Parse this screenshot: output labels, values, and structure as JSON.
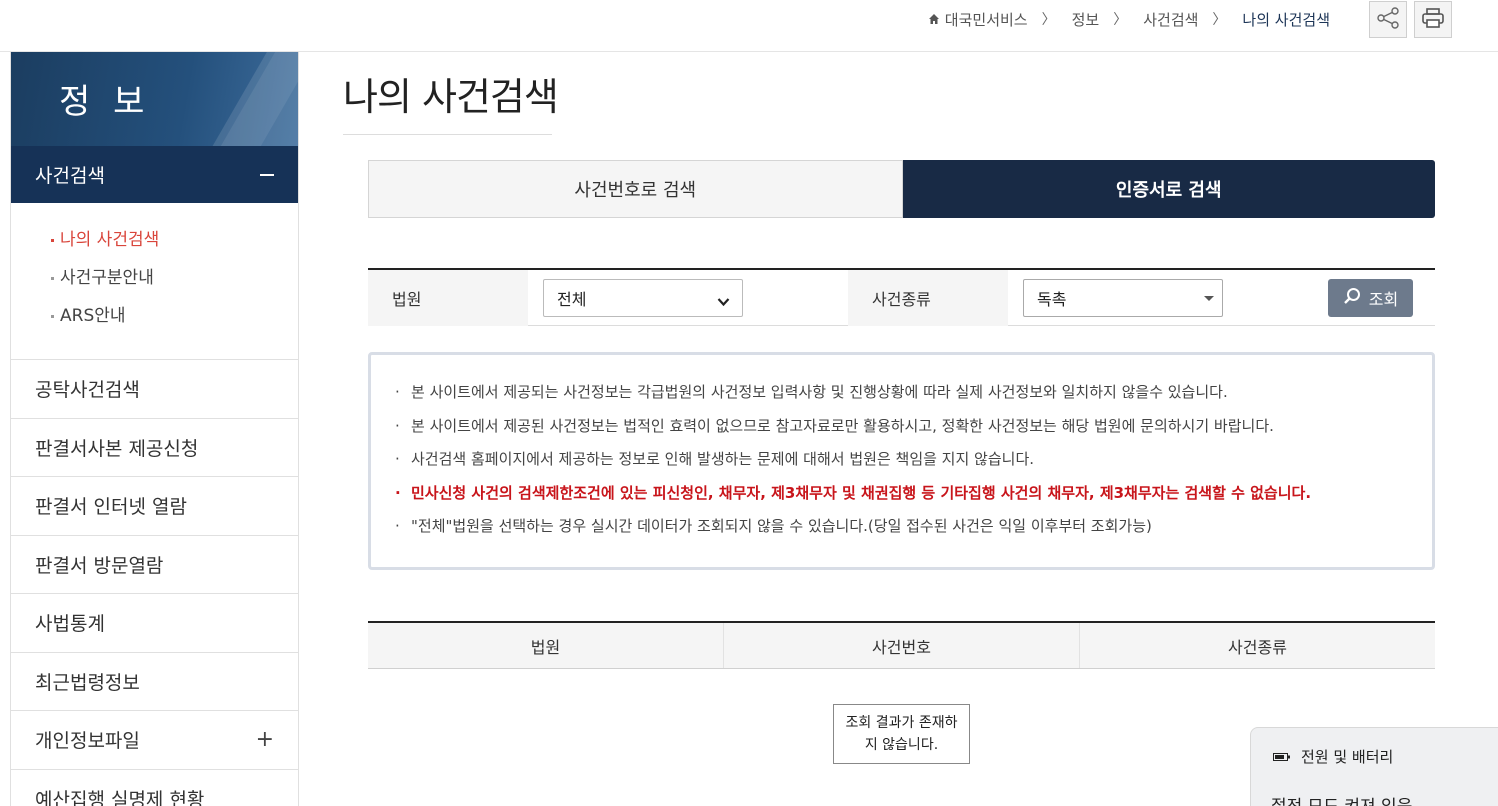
{
  "breadcrumb": {
    "items": [
      "대국민서비스",
      "정보",
      "사건검색"
    ],
    "current": "나의 사건검색",
    "separator": "〉"
  },
  "tools": {
    "share_icon": "share-icon",
    "print_icon": "print-icon"
  },
  "sidebar": {
    "heading": "정 보",
    "active_group": "사건검색",
    "sub_items": [
      "나의 사건검색",
      "사건구분안내",
      "ARS안내"
    ],
    "items": [
      {
        "label": "공탁사건검색"
      },
      {
        "label": "판결서사본 제공신청"
      },
      {
        "label": "판결서 인터넷 열람"
      },
      {
        "label": "판결서 방문열람"
      },
      {
        "label": "사법통계"
      },
      {
        "label": "최근법령정보"
      },
      {
        "label": "개인정보파일",
        "expand": "+"
      },
      {
        "label": "예산집행 실명제 현황"
      }
    ]
  },
  "main": {
    "title": "나의 사건검색",
    "tabs": [
      "사건번호로 검색",
      "인증서로 검색"
    ],
    "active_tab": "인증서로 검색",
    "search": {
      "court_label": "법원",
      "court_value": "전체",
      "type_label": "사건종류",
      "type_value": "독촉",
      "button_label": "조회"
    },
    "notices": [
      "본 사이트에서 제공되는 사건정보는 각급법원의 사건정보 입력사항 및 진행상황에 따라 실제 사건정보와 일치하지 않을수 있습니다.",
      "본 사이트에서 제공된 사건정보는 법적인 효력이 없으므로 참고자료로만 활용하시고, 정확한 사건정보는 해당 법원에 문의하시기 바랍니다.",
      "사건검색 홈페이지에서 제공하는 정보로 인해 발생하는 문제에 대해서 법원은 책임을 지지 않습니다.",
      "민사신청 사건의 검색제한조건에 있는 피신청인, 채무자, 제3채무자 및 채권집행 등 기타집행 사건의 채무자, 제3채무자는 검색할 수 없습니다.",
      "\"전체\"법원을 선택하는 경우 실시간 데이터가 조회되지 않을 수 있습니다.(당일 접수된 사건은 익일 이후부터 조회가능)"
    ],
    "bullet": "·",
    "table_headers": [
      "법원",
      "사건번호",
      "사건종류"
    ],
    "empty_message": "조회 결과가 존재하지 않습니다."
  },
  "popup": {
    "title": "전원 및 배터리",
    "line2": "절전 모드 켜져 있음"
  },
  "colors": {
    "navy": "#182a45",
    "sidebar_active": "#163257",
    "highlight_red": "#d9453b",
    "warn_red": "#c8151b",
    "search_button": "#6d7a8c"
  }
}
